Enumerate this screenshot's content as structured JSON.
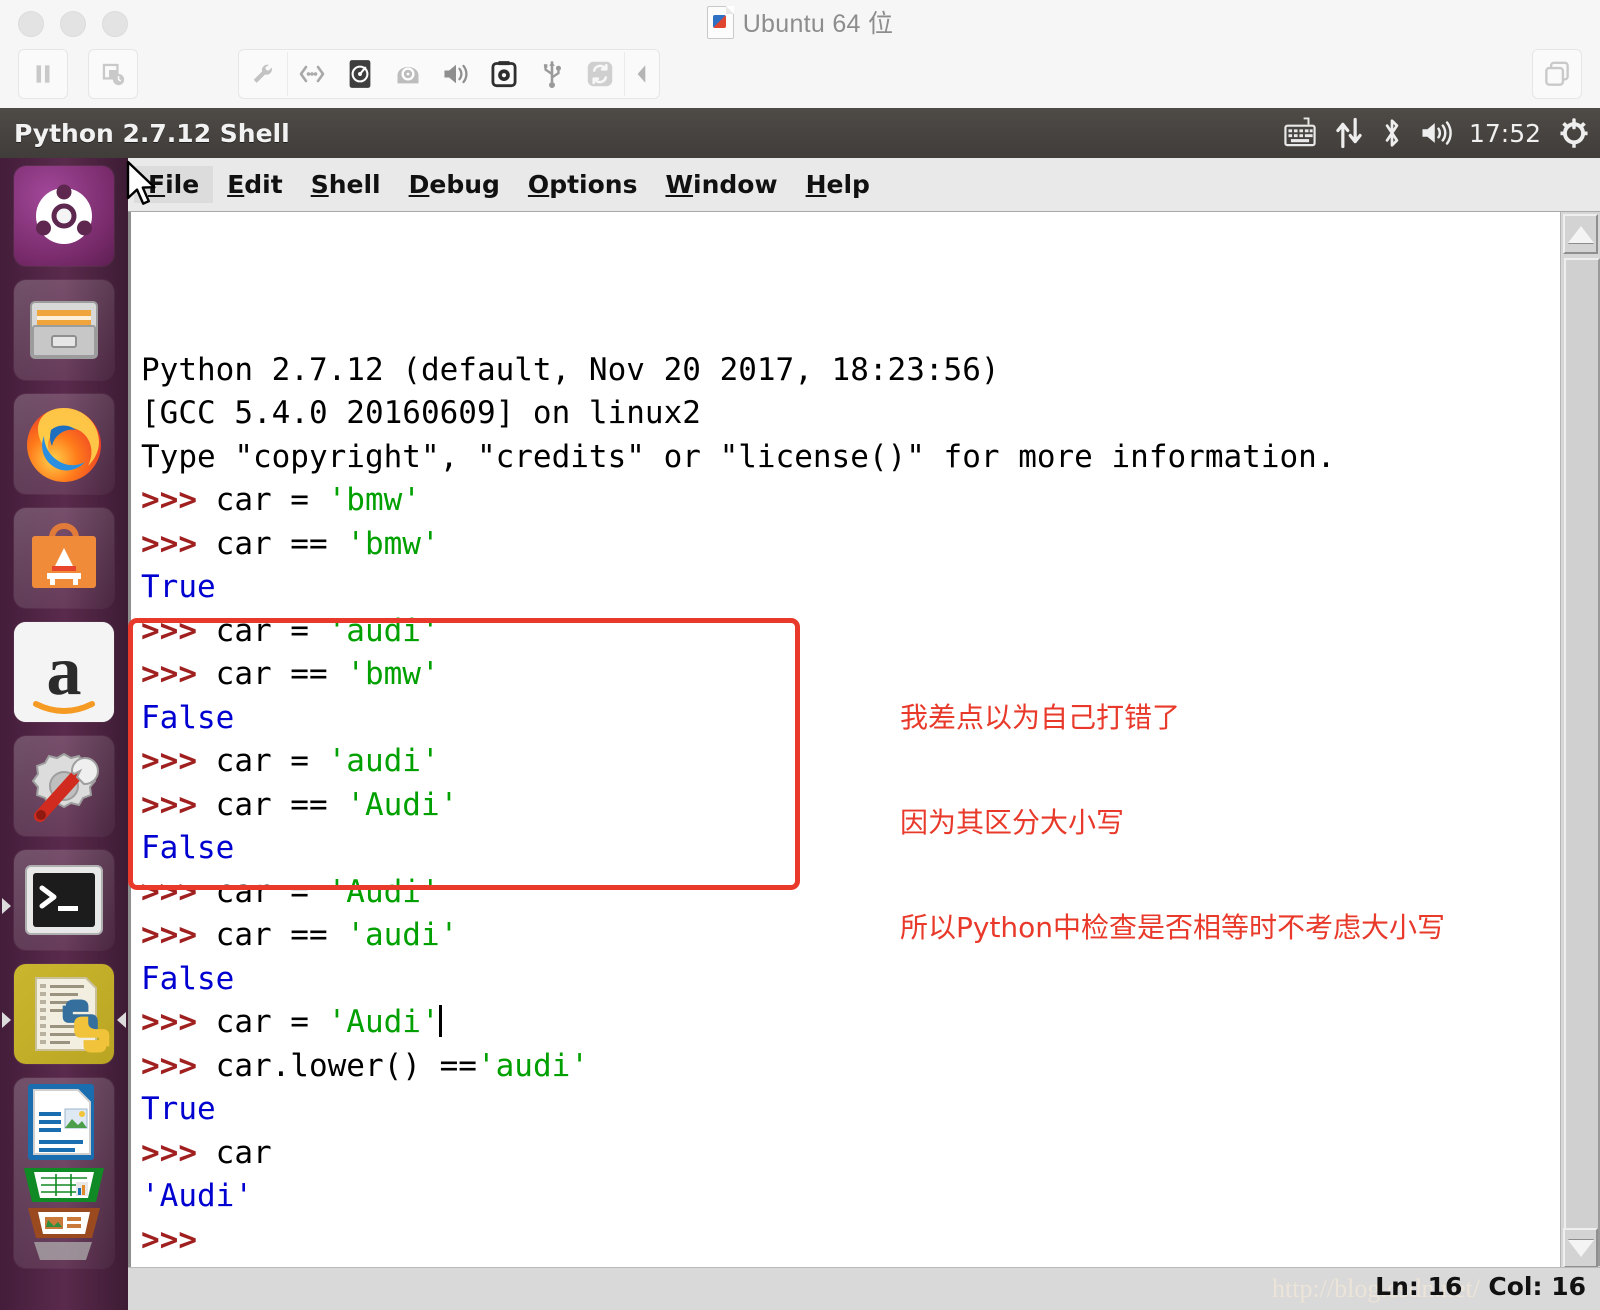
{
  "vmware": {
    "window_title": "Ubuntu 64 位",
    "title_icon": "vm-file-icon",
    "traffic_lights": [
      "close-dot",
      "minimize-dot",
      "maximize-dot"
    ],
    "left_buttons": [
      {
        "name": "pause-vm-button",
        "icon": "pause-icon"
      },
      {
        "name": "snapshot-button",
        "icon": "snapshot-clock-icon"
      }
    ],
    "device_buttons": [
      {
        "name": "settings-button",
        "icon": "wrench-icon"
      },
      {
        "name": "network-button",
        "icon": "network-icon"
      },
      {
        "name": "harddisk-button",
        "icon": "hard-disk-icon"
      },
      {
        "name": "cdrom-button",
        "icon": "cd-drive-icon"
      },
      {
        "name": "sound-button",
        "icon": "speaker-icon"
      },
      {
        "name": "camera-button",
        "icon": "camera-icon"
      },
      {
        "name": "usb-button",
        "icon": "usb-icon"
      },
      {
        "name": "sync-button",
        "icon": "sync-icon"
      },
      {
        "name": "collapse-toolbar-button",
        "icon": "chevron-left-icon"
      }
    ],
    "right_buttons": [
      {
        "name": "unity-view-button",
        "icon": "copy-window-icon"
      }
    ]
  },
  "unity_panel": {
    "title": "Python 2.7.12 Shell",
    "tray": [
      {
        "name": "keyboard-indicator",
        "icon": "keyboard-icon"
      },
      {
        "name": "network-indicator",
        "icon": "network-arrows-icon"
      },
      {
        "name": "bluetooth-indicator",
        "icon": "bluetooth-icon"
      },
      {
        "name": "volume-indicator",
        "icon": "speaker-icon"
      },
      {
        "name": "clock-indicator",
        "icon": "clock-text",
        "text": "17:52"
      },
      {
        "name": "session-indicator",
        "icon": "power-gear-icon"
      }
    ]
  },
  "launcher": {
    "items": [
      {
        "name": "launcher-item-dash",
        "label": "Ubuntu Dash",
        "icon": "ubuntu-logo-icon",
        "running": false
      },
      {
        "name": "launcher-item-files",
        "label": "Files",
        "icon": "file-cabinet-icon",
        "running": false
      },
      {
        "name": "launcher-item-firefox",
        "label": "Firefox",
        "icon": "firefox-icon",
        "running": false
      },
      {
        "name": "launcher-item-software",
        "label": "Ubuntu Software",
        "icon": "shopping-bag-icon",
        "running": false
      },
      {
        "name": "launcher-item-amazon",
        "label": "Amazon",
        "icon": "amazon-a-icon",
        "running": false
      },
      {
        "name": "launcher-item-settings",
        "label": "System Settings",
        "icon": "gear-wrench-icon",
        "running": false
      },
      {
        "name": "launcher-item-terminal",
        "label": "Terminal",
        "icon": "terminal-icon",
        "running": true
      },
      {
        "name": "launcher-item-idle",
        "label": "IDLE Python",
        "icon": "python-script-icon",
        "running": true
      },
      {
        "name": "launcher-item-libreoffice",
        "label": "LibreOffice",
        "icon": "libreoffice-stack-icon",
        "running": false
      }
    ]
  },
  "idle": {
    "menu": [
      {
        "name": "menu-file",
        "mnemonic": "F",
        "rest": "ile",
        "active": true
      },
      {
        "name": "menu-edit",
        "mnemonic": "E",
        "rest": "dit",
        "active": false
      },
      {
        "name": "menu-shell",
        "mnemonic": "S",
        "rest": "hell",
        "active": false
      },
      {
        "name": "menu-debug",
        "mnemonic": "D",
        "rest": "ebug",
        "active": false
      },
      {
        "name": "menu-options",
        "mnemonic": "O",
        "rest": "ptions",
        "active": false
      },
      {
        "name": "menu-window",
        "mnemonic": "W",
        "rest": "indow",
        "active": false
      },
      {
        "name": "menu-help",
        "mnemonic": "H",
        "rest": "elp",
        "active": false
      }
    ],
    "status": {
      "line": "Ln: 16",
      "column": "Col: 16",
      "watermark": "http://blog.csdn.net/"
    },
    "shell_lines": [
      [
        {
          "t": "Python 2.7.12 (default, Nov 20 2017, 18:23:56)",
          "c": "code"
        }
      ],
      [
        {
          "t": "[GCC 5.4.0 20160609] on linux2",
          "c": "code"
        }
      ],
      [
        {
          "t": "Type \"copyright\", \"credits\" or \"license()\" for more information.",
          "c": "code"
        }
      ],
      [
        {
          "t": ">>> ",
          "c": "prompt"
        },
        {
          "t": "car = ",
          "c": "code"
        },
        {
          "t": "'bmw'",
          "c": "str"
        }
      ],
      [
        {
          "t": ">>> ",
          "c": "prompt"
        },
        {
          "t": "car == ",
          "c": "code"
        },
        {
          "t": "'bmw'",
          "c": "str"
        }
      ],
      [
        {
          "t": "True",
          "c": "out"
        }
      ],
      [
        {
          "t": ">>> ",
          "c": "prompt"
        },
        {
          "t": "car = ",
          "c": "code"
        },
        {
          "t": "'audi'",
          "c": "str"
        }
      ],
      [
        {
          "t": ">>> ",
          "c": "prompt"
        },
        {
          "t": "car == ",
          "c": "code"
        },
        {
          "t": "'bmw'",
          "c": "str"
        }
      ],
      [
        {
          "t": "False",
          "c": "out"
        }
      ],
      [
        {
          "t": ">>> ",
          "c": "prompt"
        },
        {
          "t": "car = ",
          "c": "code"
        },
        {
          "t": "'audi'",
          "c": "str"
        }
      ],
      [
        {
          "t": ">>> ",
          "c": "prompt"
        },
        {
          "t": "car == ",
          "c": "code"
        },
        {
          "t": "'Audi'",
          "c": "str"
        }
      ],
      [
        {
          "t": "False",
          "c": "out"
        }
      ],
      [
        {
          "t": ">>> ",
          "c": "prompt"
        },
        {
          "t": "car = ",
          "c": "code"
        },
        {
          "t": "'Audi'",
          "c": "str"
        }
      ],
      [
        {
          "t": ">>> ",
          "c": "prompt"
        },
        {
          "t": "car == ",
          "c": "code"
        },
        {
          "t": "'audi'",
          "c": "str"
        }
      ],
      [
        {
          "t": "False",
          "c": "out"
        }
      ],
      [
        {
          "t": ">>> ",
          "c": "prompt"
        },
        {
          "t": "car = ",
          "c": "code"
        },
        {
          "t": "'Audi'",
          "c": "str"
        },
        {
          "t": "",
          "c": "caret"
        }
      ],
      [
        {
          "t": ">>> ",
          "c": "prompt"
        },
        {
          "t": "car.lower() ==",
          "c": "code"
        },
        {
          "t": "'audi'",
          "c": "str"
        }
      ],
      [
        {
          "t": "True",
          "c": "out"
        }
      ],
      [
        {
          "t": ">>> ",
          "c": "prompt"
        },
        {
          "t": "car",
          "c": "code"
        }
      ],
      [
        {
          "t": "'Audi'",
          "c": "out"
        }
      ],
      [
        {
          "t": ">>> ",
          "c": "prompt"
        }
      ]
    ]
  },
  "annotation": {
    "highlight_box_name": "red-highlight-box",
    "color": "#e8392a",
    "lines": [
      "我差点以为自己打错了",
      "因为其区分大小写",
      "所以Python中检查是否相等时不考虑大小写"
    ]
  }
}
